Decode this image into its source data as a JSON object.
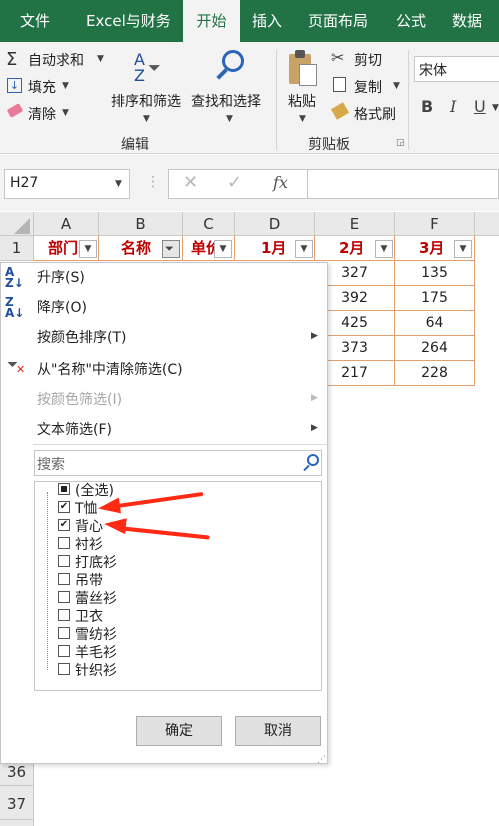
{
  "tabs": [
    {
      "label": "文件",
      "active": false
    },
    {
      "label": "Excel与财务",
      "active": false
    },
    {
      "label": "开始",
      "active": true
    },
    {
      "label": "插入",
      "active": false
    },
    {
      "label": "页面布局",
      "active": false
    },
    {
      "label": "公式",
      "active": false
    },
    {
      "label": "数据",
      "active": false
    }
  ],
  "ribbon": {
    "autosum": "自动求和",
    "fill": "填充",
    "clear": "清除",
    "sort_filter": "排序和筛选",
    "find_select": "查找和选择",
    "group_edit": "编辑",
    "paste": "粘贴",
    "cut": "剪切",
    "copy": "复制",
    "format_painter": "格式刷",
    "group_clipboard": "剪贴板",
    "font_name": "宋体",
    "bold": "B",
    "italic": "I",
    "underline": "U"
  },
  "formula_bar": {
    "name_box": "H27",
    "fx": "fx",
    "cancel": "✕",
    "enter": "✓"
  },
  "columns": [
    "A",
    "B",
    "C",
    "D",
    "E",
    "F"
  ],
  "header_row": {
    "row": "1",
    "cells": [
      "部门",
      "名称",
      "单价",
      "1月",
      "2月",
      "3月"
    ]
  },
  "data_rows": [
    {
      "e": "327",
      "f": "135"
    },
    {
      "e": "392",
      "f": "175"
    },
    {
      "e": "425",
      "f": "64"
    },
    {
      "e": "373",
      "f": "264"
    },
    {
      "e": "217",
      "f": "228"
    }
  ],
  "bottom_rows": [
    "36",
    "37"
  ],
  "menu": {
    "sort_asc": "升序(S)",
    "sort_desc": "降序(O)",
    "sort_by_color": "按颜色排序(T)",
    "clear_filter": "从\"名称\"中清除筛选(C)",
    "filter_by_color": "按颜色筛选(I)",
    "text_filter": "文本筛选(F)",
    "search_placeholder": "搜索"
  },
  "filter_items": [
    {
      "label": "(全选)",
      "state": "partial"
    },
    {
      "label": "T恤",
      "state": "checked"
    },
    {
      "label": "背心",
      "state": "checked"
    },
    {
      "label": "衬衫",
      "state": "unchecked"
    },
    {
      "label": "打底衫",
      "state": "unchecked"
    },
    {
      "label": "吊带",
      "state": "unchecked"
    },
    {
      "label": "蕾丝衫",
      "state": "unchecked"
    },
    {
      "label": "卫衣",
      "state": "unchecked"
    },
    {
      "label": "雪纺衫",
      "state": "unchecked"
    },
    {
      "label": "羊毛衫",
      "state": "unchecked"
    },
    {
      "label": "针织衫",
      "state": "unchecked"
    }
  ],
  "buttons": {
    "ok": "确定",
    "cancel": "取消"
  },
  "colors": {
    "excel_green": "#217346",
    "header_red": "#c00000",
    "cell_border": "#e3a06f",
    "arrow_red": "#ff2a14"
  }
}
